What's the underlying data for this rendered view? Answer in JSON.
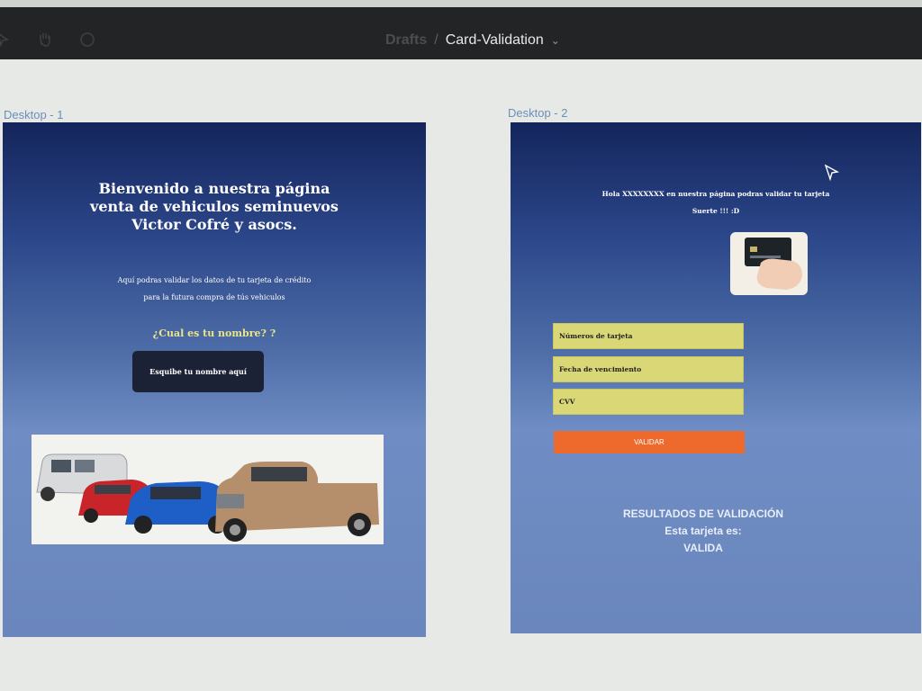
{
  "toolbar": {
    "breadcrumb_root": "Drafts",
    "separator": "/",
    "file_name": "Card-Validation",
    "icons": [
      "move-icon",
      "hand-icon",
      "comment-icon",
      "chevron-down-icon"
    ]
  },
  "frames": [
    {
      "label": "Desktop - 1",
      "welcome_lines": [
        "Bienvenido  a nuestra página",
        "venta de vehiculos seminuevos",
        "Victor Cofré y asocs."
      ],
      "sub_lines": [
        "Aquí podras validar los datos de tu tarjeta de crédito",
        "para la futura compra de tús vehiculos"
      ],
      "question": "¿Cual es tu nombre? ?",
      "name_button": "Esquibe tu nombre aquí"
    },
    {
      "label": "Desktop - 2",
      "greet_lines": [
        "Hola XXXXXXXX  en nuestra página  podras  validar tu tarjeta",
        "Suerte !!! :D"
      ],
      "fields": [
        "Números de tarjeta",
        "Fecha de vencimiento",
        "CVV"
      ],
      "validate_button": "VALIDAR",
      "results_lines": [
        "RESULTADOS DE VALIDACIÓN",
        "Esta tarjeta es:",
        "VALIDA"
      ]
    }
  ],
  "colors": {
    "toolbar_bg": "#222426",
    "frame_top": "#14255c",
    "frame_bottom": "#6a86bd",
    "field_bg": "#d9d776",
    "validate_bg": "#ee6a2c",
    "name_button_bg": "#1c2236",
    "question_text": "#e9e58a"
  }
}
